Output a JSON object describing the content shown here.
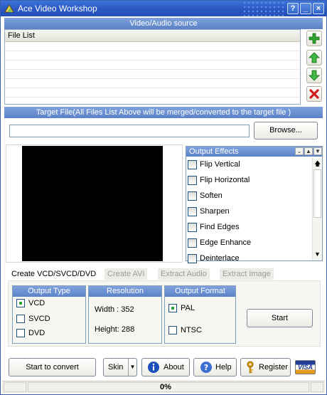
{
  "window": {
    "title": "Ace Video Workshop",
    "minimize": "?",
    "min": "_",
    "close": "×"
  },
  "source": {
    "header": "Video/Audio source",
    "column": "File List"
  },
  "target": {
    "header": "Target File(All Files List Above will be merged/converted to the target file )",
    "value": "",
    "browse": "Browse..."
  },
  "effects": {
    "header": "Output Effects",
    "items": [
      "Flip Vertical",
      "Flip Horizontal",
      "Soften",
      "Sharpen",
      "Find Edges",
      "Edge Enhance",
      "Deinterlace"
    ]
  },
  "tabs": [
    "Create VCD/SVCD/DVD",
    "Create AVI",
    "Extract Audio",
    "Extract Image"
  ],
  "output_type": {
    "header": "Output Type",
    "options": [
      "VCD",
      "SVCD",
      "DVD"
    ],
    "selected": "VCD"
  },
  "resolution": {
    "header": "Resolution",
    "width": "Width : 352",
    "height": "Height: 288"
  },
  "output_format": {
    "header": "Output Format",
    "options": [
      "PAL",
      "NTSC"
    ],
    "selected": "PAL"
  },
  "buttons": {
    "start": "Start",
    "start_convert": "Start to convert",
    "skin": "Skin",
    "about": "About",
    "help": "Help",
    "register": "Register",
    "visa": "VISA"
  },
  "status": {
    "progress": "0%"
  },
  "colors": {
    "titlebar": "#2a57c4",
    "header_bar": "#6b90d4",
    "add": "#2ea52e",
    "remove": "#d01c1c"
  }
}
